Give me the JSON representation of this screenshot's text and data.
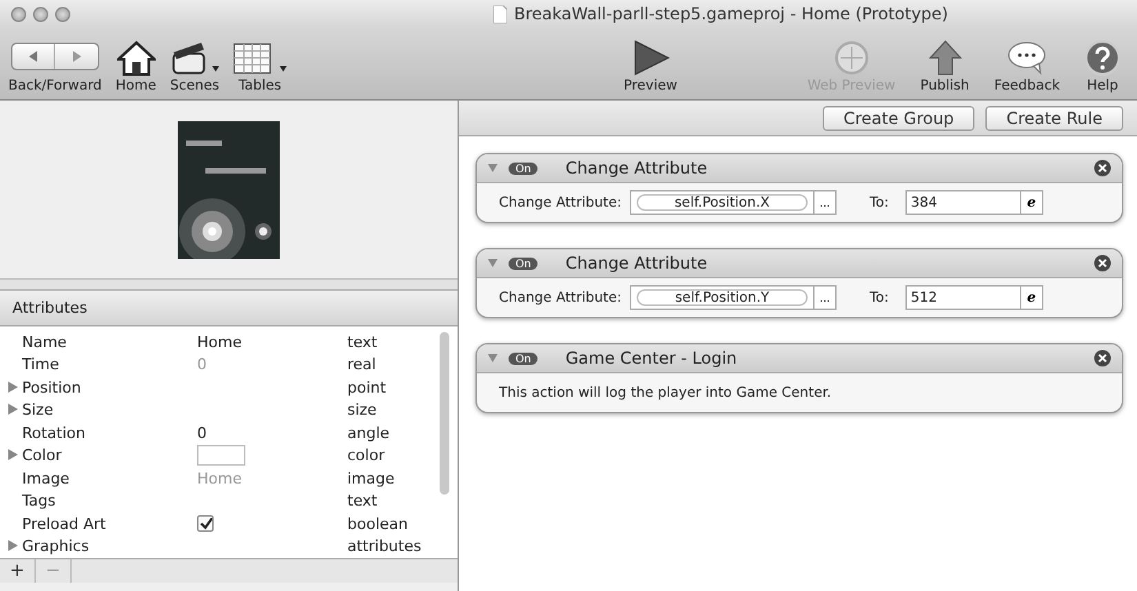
{
  "window": {
    "title": "BreakaWall-parll-step5.gameproj - Home (Prototype)"
  },
  "toolbar": {
    "left": [
      {
        "kind": "nav",
        "label": "Back/Forward"
      },
      {
        "kind": "home",
        "label": "Home",
        "dropdown": false
      },
      {
        "kind": "scenes",
        "label": "Scenes",
        "dropdown": true
      },
      {
        "kind": "tables",
        "label": "Tables",
        "dropdown": true
      }
    ],
    "center": [
      {
        "kind": "preview",
        "label": "Preview",
        "disabled": false
      }
    ],
    "right": [
      {
        "kind": "web",
        "label": "Web Preview",
        "disabled": true
      },
      {
        "kind": "publish",
        "label": "Publish",
        "disabled": false
      },
      {
        "kind": "feedback",
        "label": "Feedback",
        "disabled": false
      },
      {
        "kind": "help",
        "label": "Help",
        "disabled": false
      }
    ]
  },
  "attributes": {
    "title": "Attributes",
    "rows": [
      {
        "name": "Name",
        "expandable": false,
        "kind": "text",
        "value": "Home",
        "type": "text"
      },
      {
        "name": "Time",
        "expandable": false,
        "kind": "muted",
        "value": "0",
        "type": "real"
      },
      {
        "name": "Position",
        "expandable": true,
        "kind": "none",
        "type": "point"
      },
      {
        "name": "Size",
        "expandable": true,
        "kind": "none",
        "type": "size"
      },
      {
        "name": "Rotation",
        "expandable": false,
        "kind": "text",
        "value": "0",
        "type": "angle"
      },
      {
        "name": "Color",
        "expandable": true,
        "kind": "swatch",
        "type": "color"
      },
      {
        "name": "Image",
        "expandable": false,
        "kind": "muted",
        "value": "Home",
        "type": "image"
      },
      {
        "name": "Tags",
        "expandable": false,
        "kind": "none",
        "type": "text"
      },
      {
        "name": "Preload Art",
        "expandable": false,
        "kind": "checkbox",
        "checked": true,
        "type": "boolean"
      },
      {
        "name": "Graphics",
        "expandable": true,
        "kind": "none",
        "type": "attributes"
      }
    ],
    "add": "+",
    "remove": "−"
  },
  "actions": {
    "buttons": [
      "Create Group",
      "Create Rule"
    ],
    "cards": [
      {
        "kind": "change",
        "on": true,
        "toggle": "On",
        "title": "Change Attribute",
        "label": "Change Attribute:",
        "attribute": "self.Position.X",
        "browse": "...",
        "to_label": "To:",
        "to": "384",
        "expr": "e"
      },
      {
        "kind": "change",
        "on": true,
        "toggle": "On",
        "title": "Change Attribute",
        "label": "Change Attribute:",
        "attribute": "self.Position.Y",
        "browse": "...",
        "to_label": "To:",
        "to": "512",
        "expr": "e"
      },
      {
        "kind": "message",
        "on": true,
        "toggle": "On",
        "title": "Game Center - Login",
        "text": "This action will log the player into Game Center."
      }
    ]
  }
}
